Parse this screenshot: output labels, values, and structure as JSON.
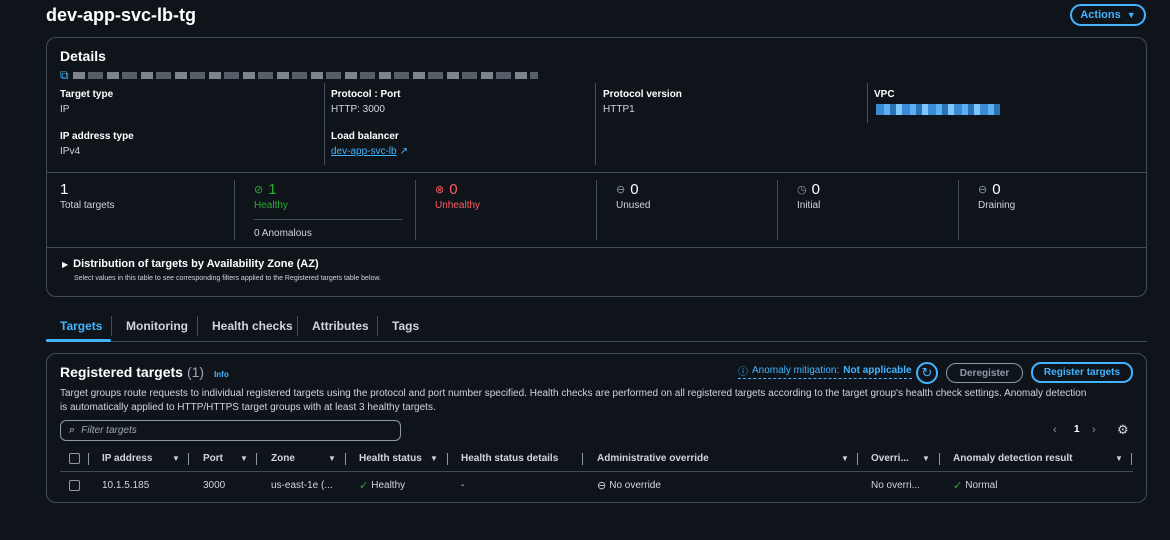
{
  "header": {
    "title": "dev-app-svc-lb-tg",
    "actions_label": "Actions",
    "actions_icon": "caret-down-icon"
  },
  "details": {
    "title": "Details",
    "fields": {
      "target_type_label": "Target type",
      "target_type_value": "IP",
      "ip_address_type_label": "IP address type",
      "ip_address_type_value": "IPv4",
      "protocol_port_label": "Protocol : Port",
      "protocol_port_value": "HTTP: 3000",
      "load_balancer_label": "Load balancer",
      "load_balancer_value": "dev-app-svc-lb",
      "protocol_version_label": "Protocol version",
      "protocol_version_value": "HTTP1",
      "vpc_label": "VPC"
    },
    "stats": [
      {
        "count": "1",
        "label": "Total targets"
      },
      {
        "count": "1",
        "label": "Healthy",
        "sub": "0 Anomalous"
      },
      {
        "count": "0",
        "label": "Unhealthy"
      },
      {
        "count": "0",
        "label": "Unused"
      },
      {
        "count": "0",
        "label": "Initial"
      },
      {
        "count": "0",
        "label": "Draining"
      }
    ],
    "distribution": {
      "title": "Distribution of targets by Availability Zone (AZ)",
      "subtitle": "Select values in this table to see corresponding filters applied to the Registered targets table below."
    }
  },
  "tabs": [
    {
      "label": "Targets"
    },
    {
      "label": "Monitoring"
    },
    {
      "label": "Health checks"
    },
    {
      "label": "Attributes"
    },
    {
      "label": "Tags"
    }
  ],
  "registered": {
    "title": "Registered targets",
    "count": "(1)",
    "info": "Info",
    "anomaly_label": "Anomaly mitigation:",
    "anomaly_value": "Not applicable",
    "deregister_label": "Deregister",
    "register_label": "Register targets",
    "description": "Target groups route requests to individual registered targets using the protocol and port number specified. Health checks are performed on all registered targets according to the target group's health check settings. Anomaly detection is automatically applied to HTTP/HTTPS target groups with at least 3 healthy targets.",
    "search_placeholder": "Filter targets",
    "page_number": "1",
    "columns": [
      "IP address",
      "Port",
      "Zone",
      "Health status",
      "Health status details",
      "Administrative override",
      "Overri...",
      "Anomaly detection result"
    ],
    "rows": [
      {
        "ip": "10.1.5.185",
        "port": "3000",
        "zone": "us-east-1e (...",
        "health": "Healthy",
        "details": "-",
        "admin_override": "No override",
        "override": "No overri...",
        "anomaly": "Normal"
      }
    ]
  },
  "colors": {
    "accent": "#42b4ff",
    "healthy": "#29ad32",
    "unhealthy": "#ff5d64",
    "background": "#0f141a",
    "border": "#414d5c"
  }
}
